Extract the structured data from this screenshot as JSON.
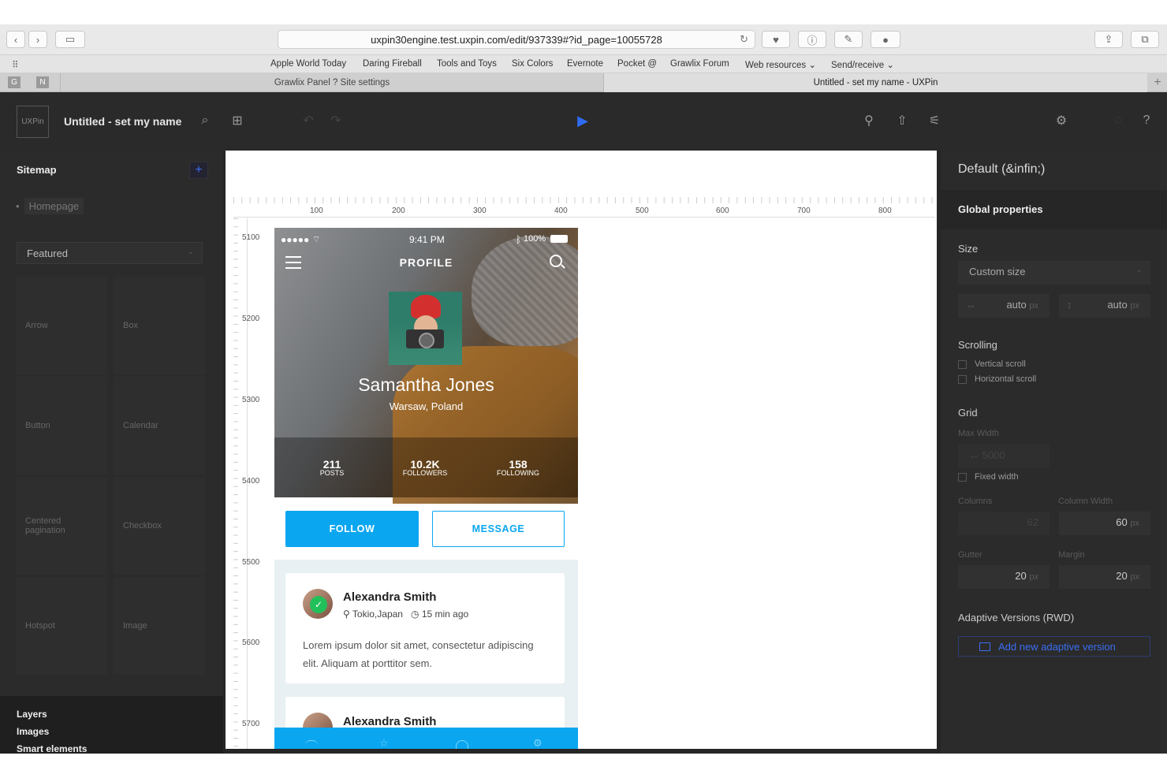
{
  "browser": {
    "url": "uxpin30engine.test.uxpin.com/edit/937339#?id_page=10055728",
    "bookmarks": [
      "Apple World Today",
      "Daring Fireball",
      "Tools and Toys",
      "Six Colors",
      "Evernote",
      "Pocket @",
      "Grawlix Forum",
      "Web resources ⌄",
      "Send/receive ⌄"
    ],
    "tabs": [
      {
        "label": "Grawlix Panel ? Site settings"
      },
      {
        "label": "Untitled - set my name - UXPin"
      }
    ],
    "pinned": [
      "G",
      "N"
    ]
  },
  "app": {
    "logo": "UXPin",
    "project_title": "Untitled - set my name"
  },
  "sitemap": {
    "title": "Sitemap",
    "add": "+",
    "home": "Homepage"
  },
  "library": {
    "selected": "Featured",
    "items": [
      "Arrow",
      "Box",
      "Button",
      "Calendar",
      "Centered pagination",
      "Checkbox",
      "Hotspot",
      "Image"
    ]
  },
  "left_bottom": [
    "Layers",
    "Images",
    "Smart elements"
  ],
  "ruler": {
    "h": [
      "100",
      "200",
      "300",
      "400",
      "500",
      "600",
      "700",
      "800"
    ],
    "v": [
      "5100",
      "5200",
      "5300",
      "5400",
      "5500",
      "5600",
      "5700"
    ]
  },
  "phone": {
    "status_left": "●●●●● ",
    "time": "9:41 PM",
    "battery": "100%",
    "title": "PROFILE",
    "name": "Samantha Jones",
    "location": "Warsaw, Poland",
    "stats": [
      {
        "num": "211",
        "label": "POSTS"
      },
      {
        "num": "10.2K",
        "label": "FOLLOWERS"
      },
      {
        "num": "158",
        "label": "FOLLOWING"
      }
    ],
    "follow": "FOLLOW",
    "message": "MESSAGE",
    "posts": [
      {
        "name": "Alexandra Smith",
        "place": "Tokio,Japan",
        "time": "15 min ago",
        "text": "Lorem ipsum dolor sit amet, consectetur adipiscing elit. Aliquam at porttitor sem."
      },
      {
        "name": "Alexandra Smith"
      }
    ],
    "accent": "#0aa6f0"
  },
  "properties": {
    "title": "Default (&infin;)",
    "global": "Global properties",
    "size_label": "Size",
    "size_value": "Custom size",
    "width": "auto",
    "height": "auto",
    "unit": "px",
    "scrolling": "Scrolling",
    "vertical": "Vertical scroll",
    "horizontal": "Horizontal scroll",
    "grid": "Grid",
    "max_width_label": "Max Width",
    "max_width": "5000",
    "fixed": "Fixed width",
    "columns_label": "Columns",
    "columns": "62",
    "colwidth_label": "Column Width",
    "colwidth": "60",
    "gutter_label": "Gutter",
    "gutter": "20",
    "margin_label": "Margin",
    "margin": "20",
    "adaptive": "Adaptive Versions (RWD)",
    "add_adaptive": "Add new adaptive version"
  }
}
